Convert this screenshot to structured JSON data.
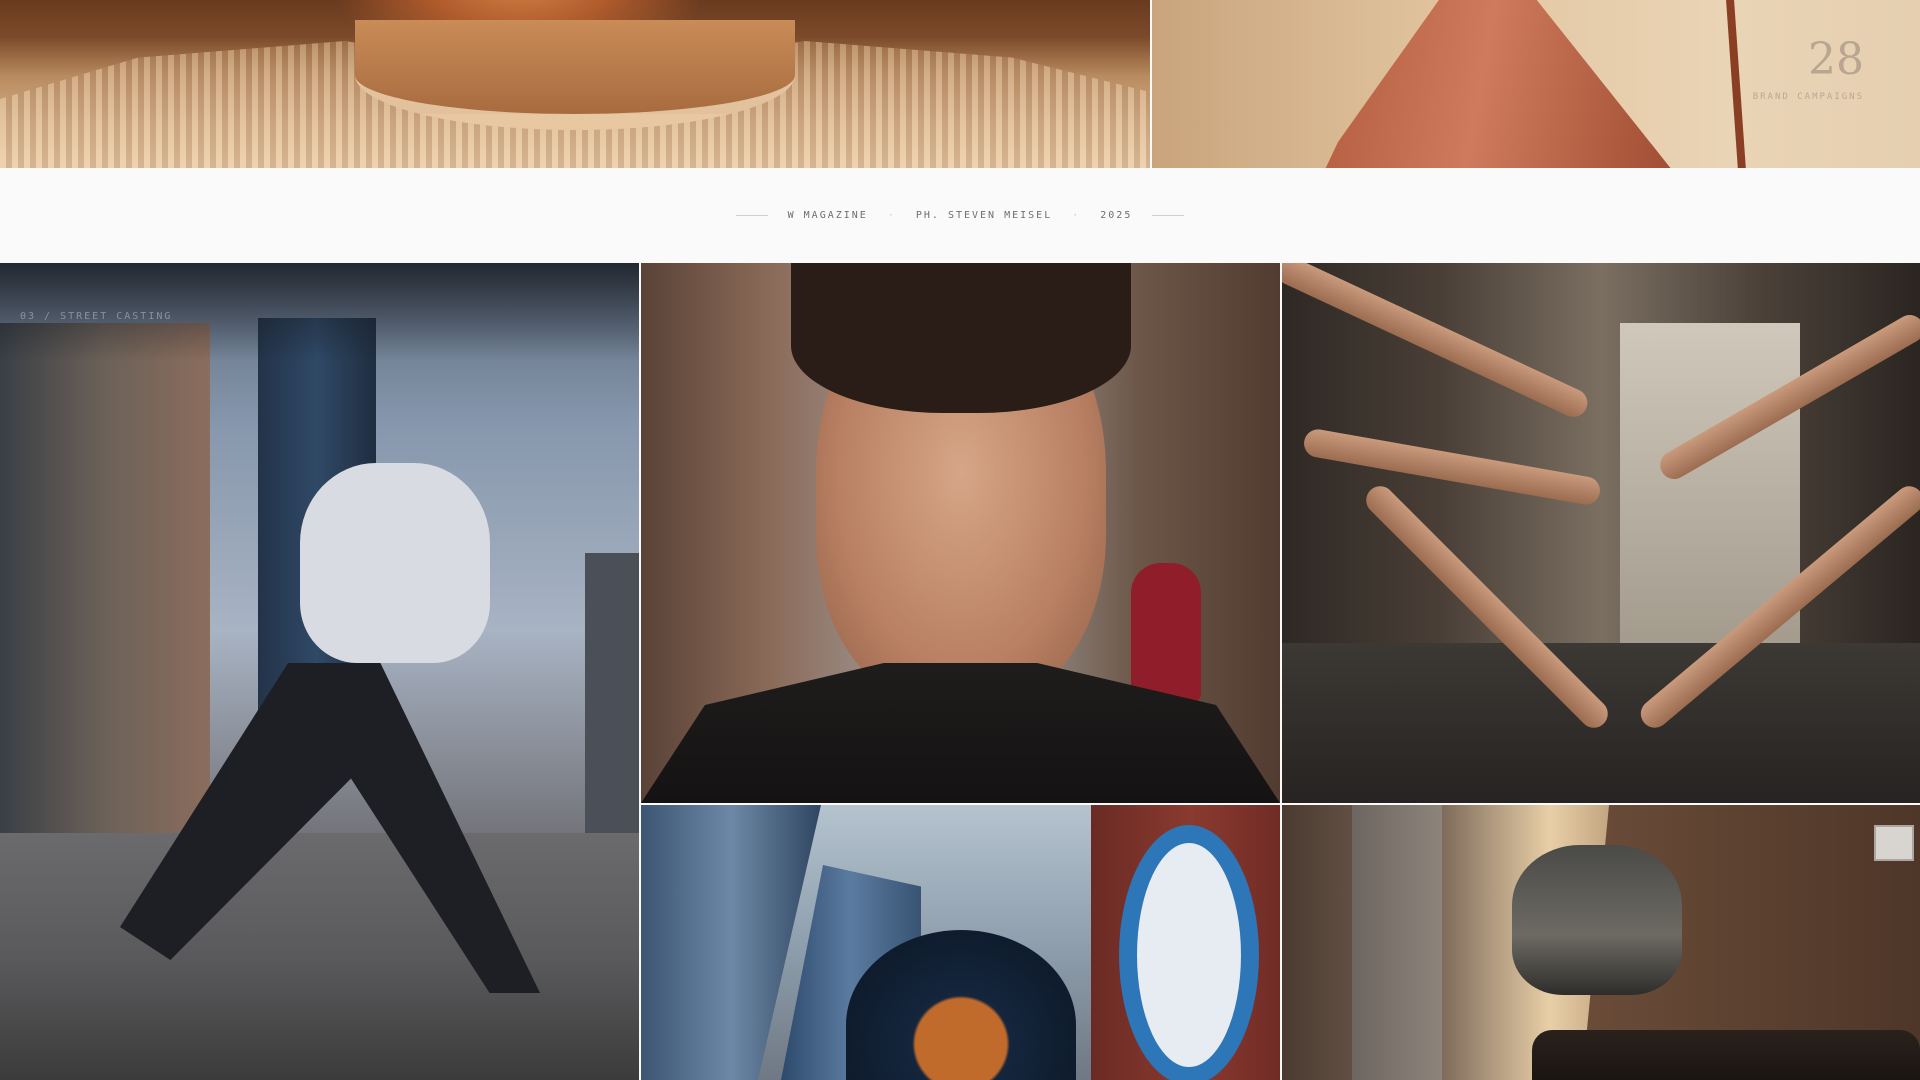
{
  "stat": {
    "number": "28",
    "label": "BRAND CAMPAIGNS"
  },
  "credits": {
    "publication": "W MAGAZINE",
    "separator": "·",
    "photographer": "PH. STEVEN MEISEL",
    "year": "2025"
  },
  "captions": {
    "street": "03 / STREET CASTING"
  },
  "gallery": {
    "images": [
      {
        "id": "sweater-closeup",
        "icon": "photo"
      },
      {
        "id": "terracotta-dress",
        "icon": "photo"
      },
      {
        "id": "street-runner",
        "icon": "photo"
      },
      {
        "id": "portrait-city",
        "icon": "photo"
      },
      {
        "id": "reaching-hands",
        "icon": "photo"
      },
      {
        "id": "hooded-skyline",
        "icon": "photo"
      },
      {
        "id": "street-jump",
        "icon": "photo"
      }
    ]
  },
  "colors": {
    "background": "#fafafa",
    "credit_text": "#6f6f6f",
    "stat_text": "#b8a691"
  }
}
